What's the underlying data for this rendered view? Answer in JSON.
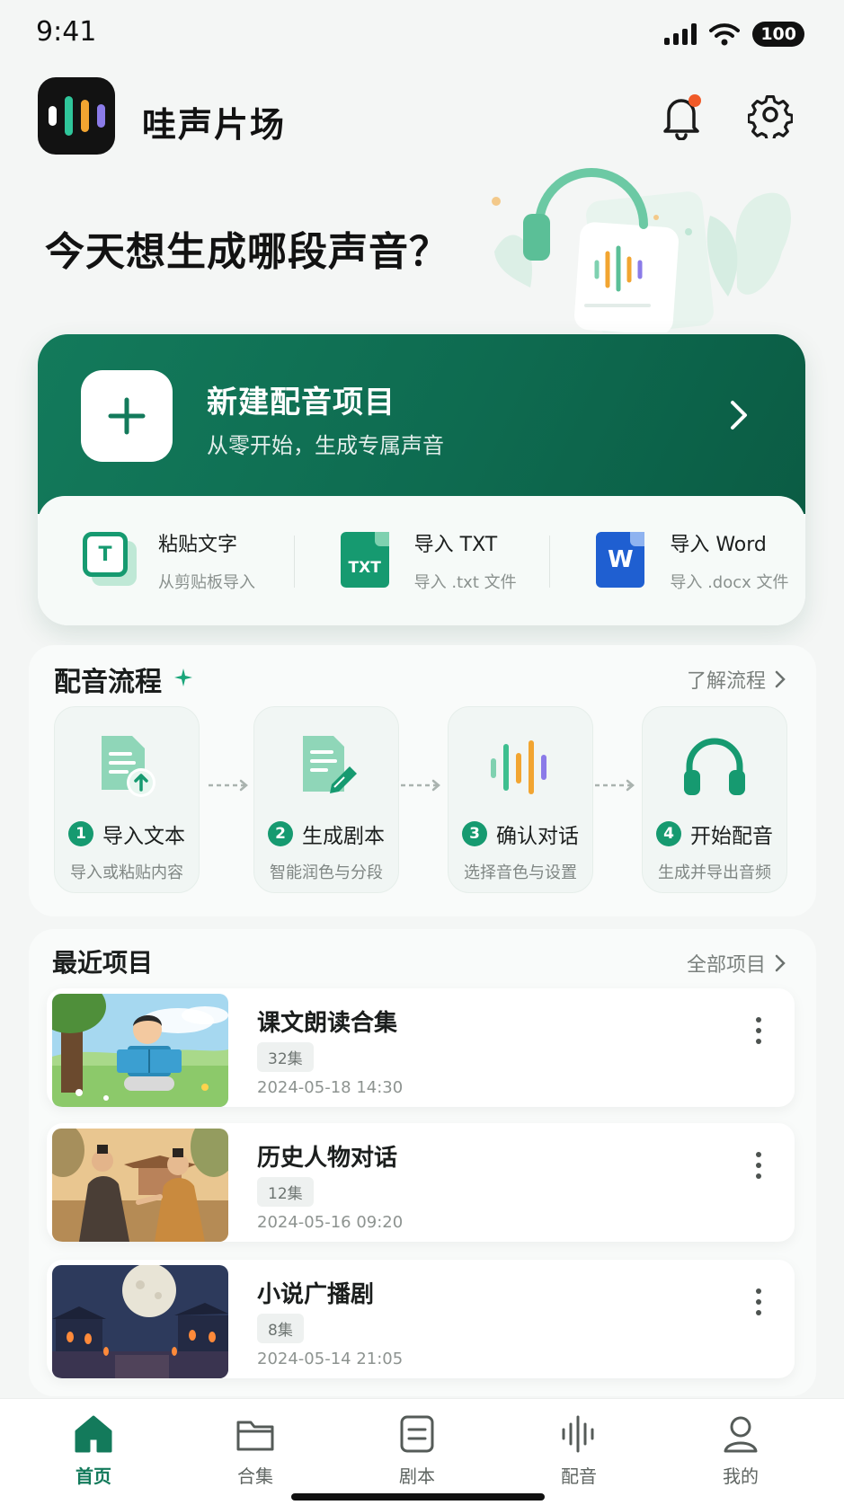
{
  "status_bar": {
    "time": "9:41",
    "battery": "100"
  },
  "header": {
    "app_title": "哇声片场"
  },
  "headline": "今天想生成哪段声音？",
  "new_project": {
    "title": "新建配音项目",
    "subtitle": "从零开始，生成专属声音"
  },
  "import_options": [
    {
      "title": "粘贴文字",
      "subtitle": "从剪贴板导入",
      "icon": "paste-text-icon",
      "badge": "T"
    },
    {
      "title": "导入 TXT",
      "subtitle": "导入 .txt 文件",
      "icon": "txt-file-icon",
      "badge": "TXT"
    },
    {
      "title": "导入 Word",
      "subtitle": "导入 .docx 文件",
      "icon": "word-file-icon",
      "badge": "W"
    }
  ],
  "flow": {
    "title": "配音流程",
    "link": "了解流程",
    "steps": [
      {
        "num": "1",
        "title": "导入文本",
        "subtitle": "导入或粘贴内容",
        "icon": "import-document-icon"
      },
      {
        "num": "2",
        "title": "生成剧本",
        "subtitle": "智能润色与分段",
        "icon": "edit-document-icon"
      },
      {
        "num": "3",
        "title": "确认对话",
        "subtitle": "选择音色与设置",
        "icon": "waveform-icon"
      },
      {
        "num": "4",
        "title": "开始配音",
        "subtitle": "生成并导出音频",
        "icon": "headphones-icon"
      }
    ]
  },
  "recent": {
    "title": "最近项目",
    "link": "全部项目",
    "projects": [
      {
        "title": "课文朗读合集",
        "episodes": "32集",
        "date": "2024-05-18   14:30"
      },
      {
        "title": "历史人物对话",
        "episodes": "12集",
        "date": "2024-05-16   09:20"
      },
      {
        "title": "小说广播剧",
        "episodes": "8集",
        "date": "2024-05-14   21:05"
      }
    ]
  },
  "tabs": [
    {
      "label": "首页",
      "icon": "home-icon",
      "active": true
    },
    {
      "label": "合集",
      "icon": "folder-icon",
      "active": false
    },
    {
      "label": "剧本",
      "icon": "script-icon",
      "active": false
    },
    {
      "label": "配音",
      "icon": "waveform-icon",
      "active": false
    },
    {
      "label": "我的",
      "icon": "user-icon",
      "active": false
    }
  ],
  "colors": {
    "primary": "#137a5b",
    "accent_green": "#169a70",
    "notification_dot": "#f05a28",
    "word_blue": "#1f5fd1"
  }
}
